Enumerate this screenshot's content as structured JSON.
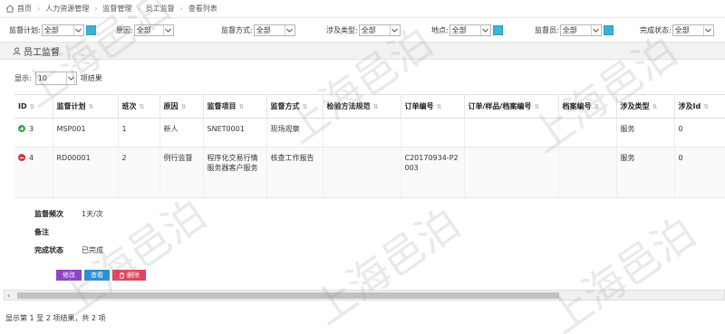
{
  "breadcrumb": [
    "首页",
    "人力资源管理",
    "监督管理",
    "员工监督",
    "查看列表"
  ],
  "filters": [
    {
      "label": "监督计划:",
      "value": "全部"
    },
    {
      "label": "原因:",
      "value": "全部"
    },
    {
      "label": "监督方式:",
      "value": "全部"
    },
    {
      "label": "涉及类型:",
      "value": "全部"
    },
    {
      "label": "地点:",
      "value": "全部"
    },
    {
      "label": "监督员:",
      "value": "全部"
    },
    {
      "label": "完成状态:",
      "value": "全部"
    }
  ],
  "section": {
    "title": "员工监督"
  },
  "page_size": {
    "prefix": "显示",
    "value": "10",
    "suffix": "项结果"
  },
  "table": {
    "headers": [
      "ID",
      "监督计划",
      "班次",
      "原因",
      "监督项目",
      "监督方式",
      "检验方法规范",
      "订单编号",
      "订单/样品/档案编号",
      "档案编号",
      "涉及类型",
      "涉及Id"
    ],
    "rows": [
      {
        "id": "3",
        "plan": "MSP001",
        "shift": "1",
        "reason": "新人",
        "item": "SNET0001",
        "method": "现场观察",
        "spec": "",
        "order": "",
        "order_sample": "",
        "archive": "",
        "type": "服务",
        "related_id": "0"
      },
      {
        "id": "4",
        "plan": "RD00001",
        "shift": "2",
        "reason": "例行监督",
        "item": "程序化交易行情服务器客户服务",
        "method": "核查工作报告",
        "spec": "",
        "order": "C20170934-P2003",
        "order_sample": "",
        "archive": "",
        "type": "服务",
        "related_id": "0"
      }
    ]
  },
  "detail": {
    "freq_label": "监督频次",
    "freq_value": "1天/次",
    "note_label": "备注",
    "note_value": "",
    "status_label": "完成状态",
    "status_value": "已完成"
  },
  "buttons": {
    "edit": "修改",
    "view": "查看",
    "delete": "删除"
  },
  "footer": "显示第 1 至 2 项结果，共 2 项",
  "watermark": "上海邑泊",
  "colors": {
    "add_icon": "#3aa54a",
    "remove_icon": "#d9363e",
    "edit_btn": "#8e44c6",
    "view_btn": "#2b8fd6",
    "delete_btn": "#e2425b",
    "filter_button": "#3ab3d6"
  }
}
